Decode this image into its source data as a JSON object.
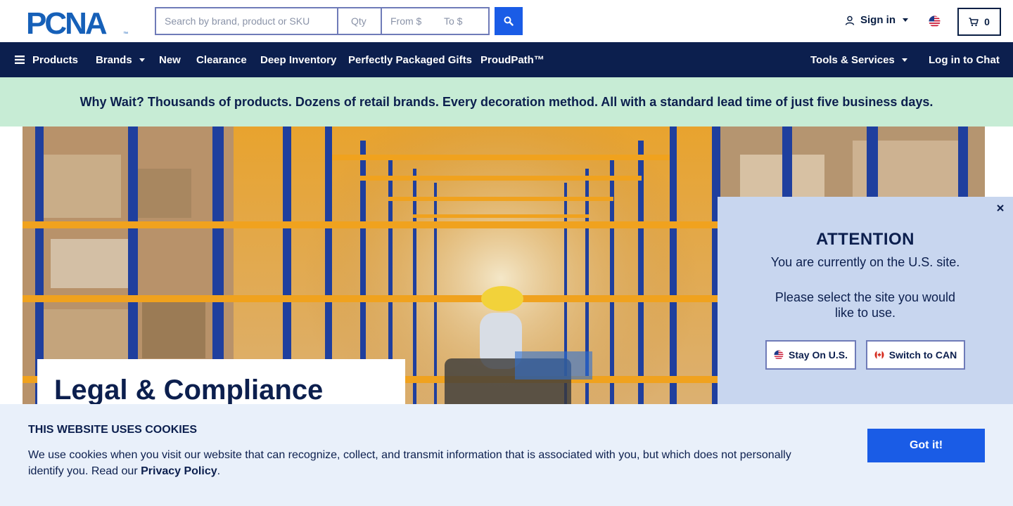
{
  "header": {
    "logo_text": "PCNA",
    "logo_trademark": "™",
    "search": {
      "placeholder": "Search by brand, product or SKU",
      "value": ""
    },
    "qty": {
      "placeholder": "Qty",
      "value": ""
    },
    "price_from": {
      "placeholder": "From $",
      "value": ""
    },
    "price_to": {
      "placeholder": "To $",
      "value": ""
    },
    "search_icon": "search-icon",
    "sign_in_label": "Sign in",
    "cart_count": "0",
    "country_flag": "us-flag"
  },
  "nav": {
    "products": "Products",
    "brands": "Brands",
    "new": "New",
    "clearance": "Clearance",
    "deep_inventory": "Deep Inventory",
    "gifts": "Perfectly Packaged Gifts",
    "proudpath": "ProudPath™",
    "tools": "Tools & Services",
    "chat": "Log in to Chat"
  },
  "promo": {
    "text": "Why Wait? Thousands of products. Dozens of retail brands. Every decoration method. All with a standard lead time of just five business days."
  },
  "hero": {
    "title": "Legal & Compliance"
  },
  "attention": {
    "heading": "ATTENTION",
    "current_site": "You are currently on the U.S. site.",
    "prompt": "Please select the site you would like to use.",
    "stay_label": "Stay On U.S.",
    "switch_label": "Switch to CAN"
  },
  "cookie": {
    "heading": "THIS WEBSITE USES COOKIES",
    "body": "We use cookies when you visit our website that can recognize, collect, and transmit information that is associated with you, but which does not personally identify you. Read our ",
    "policy_link": "Privacy Policy",
    "period": ".",
    "button": "Got it!"
  },
  "colors": {
    "navy": "#0c1f4e",
    "accent_blue": "#1a5ce6",
    "promo_green": "#c7ecd5",
    "attention_bg": "#c8d6ef",
    "cookie_bg": "#e9f0fa"
  }
}
